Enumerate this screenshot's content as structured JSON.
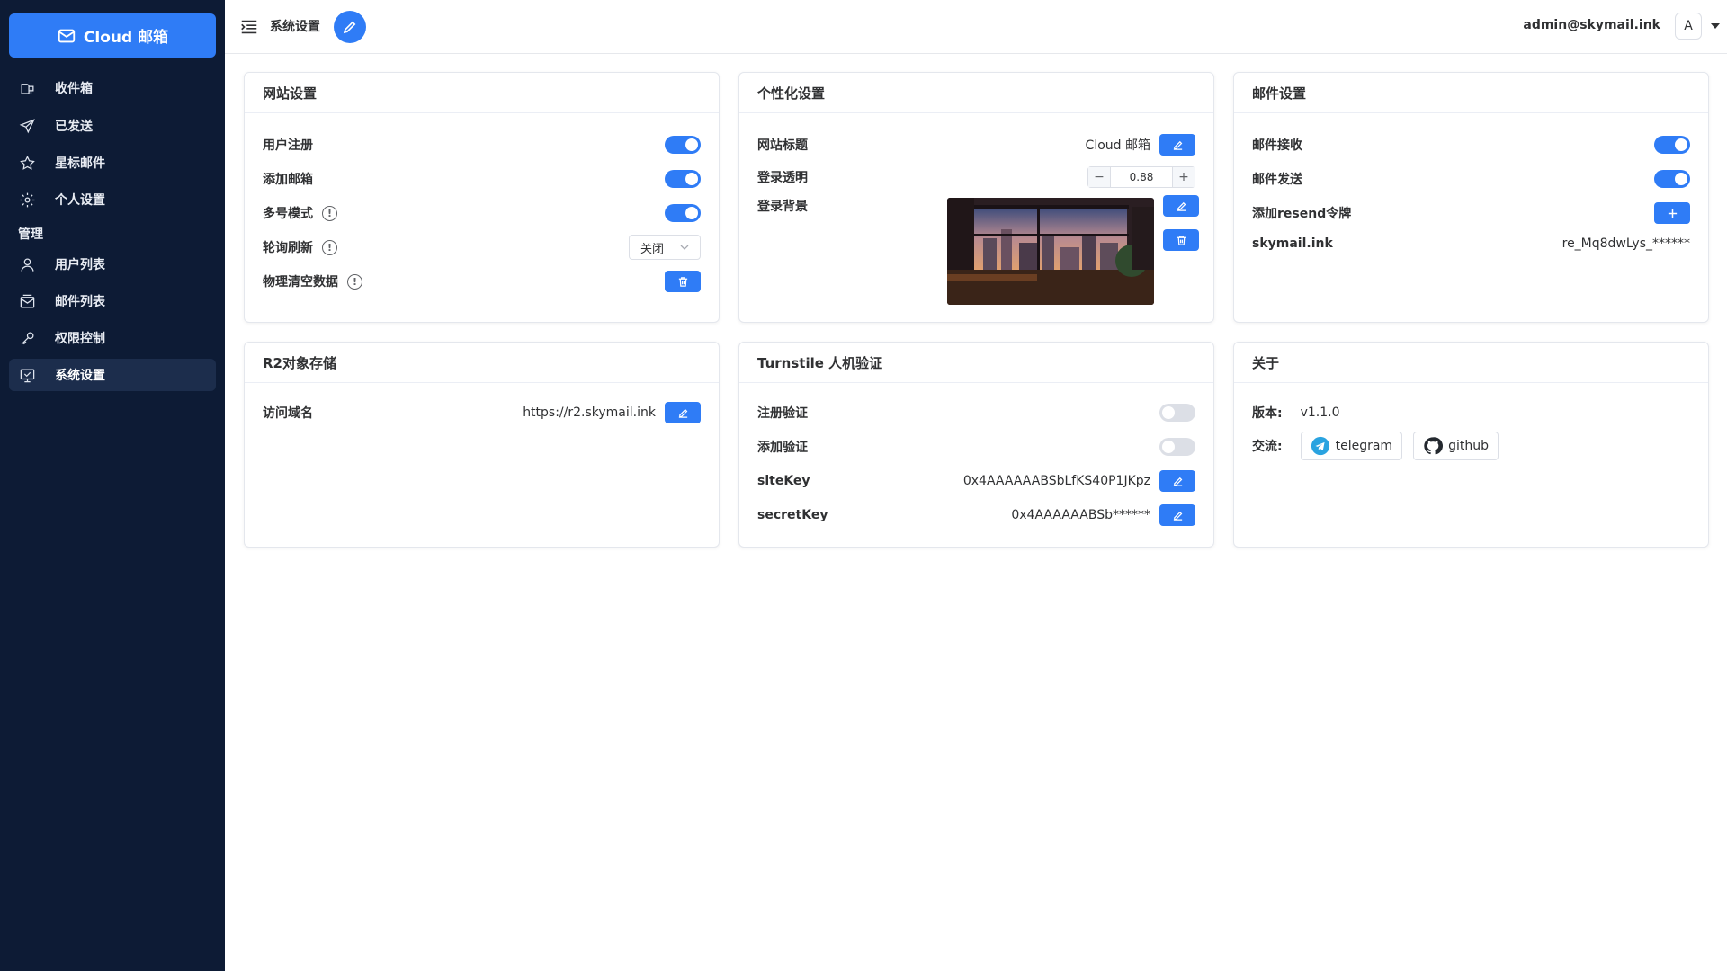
{
  "brand": {
    "name": "Cloud 邮箱"
  },
  "sidebar": {
    "items": [
      {
        "label": "收件箱"
      },
      {
        "label": "已发送"
      },
      {
        "label": "星标邮件"
      },
      {
        "label": "个人设置"
      },
      {
        "label": "用户列表"
      },
      {
        "label": "邮件列表"
      },
      {
        "label": "权限控制"
      },
      {
        "label": "系统设置"
      }
    ],
    "group_label": "管理"
  },
  "header": {
    "breadcrumb": "系统设置",
    "user_email": "admin@skymail.ink",
    "avatar_letter": "A"
  },
  "site_settings": {
    "title": "网站设置",
    "user_register": "用户注册",
    "add_mailbox": "添加邮箱",
    "multi_mode": "多号模式",
    "poll_refresh": "轮询刷新",
    "poll_value": "关闭",
    "physical_clear": "物理清空数据"
  },
  "personalize": {
    "title": "个性化设置",
    "site_title_label": "网站标题",
    "site_title_value": "Cloud 邮箱",
    "login_opacity_label": "登录透明",
    "login_opacity_value": "0.88",
    "login_bg_label": "登录背景"
  },
  "mail_settings": {
    "title": "邮件设置",
    "receive": "邮件接收",
    "send": "邮件发送",
    "add_resend": "添加resend令牌",
    "domain": "skymail.ink",
    "token": "re_Mq8dwLys_******"
  },
  "r2": {
    "title": "R2对象存储",
    "domain_label": "访问域名",
    "domain_value": "https://r2.skymail.ink"
  },
  "turnstile": {
    "title": "Turnstile 人机验证",
    "register_verify": "注册验证",
    "add_verify": "添加验证",
    "site_key_label": "siteKey",
    "site_key_value": "0x4AAAAAABSbLfKS40P1JKpz",
    "secret_key_label": "secretKey",
    "secret_key_value": "0x4AAAAAABSb******"
  },
  "about": {
    "title": "关于",
    "version_label": "版本:",
    "version_value": "v1.1.0",
    "contact_label": "交流:",
    "telegram": "telegram",
    "github": "github"
  },
  "colors": {
    "sidebar_bg": "#0d1b35",
    "accent": "#2f7cf6"
  },
  "toggles": {
    "user_register": true,
    "add_mailbox": true,
    "multi_mode": true,
    "mail_receive": true,
    "mail_send": true,
    "register_verify": false,
    "add_verify": false
  }
}
